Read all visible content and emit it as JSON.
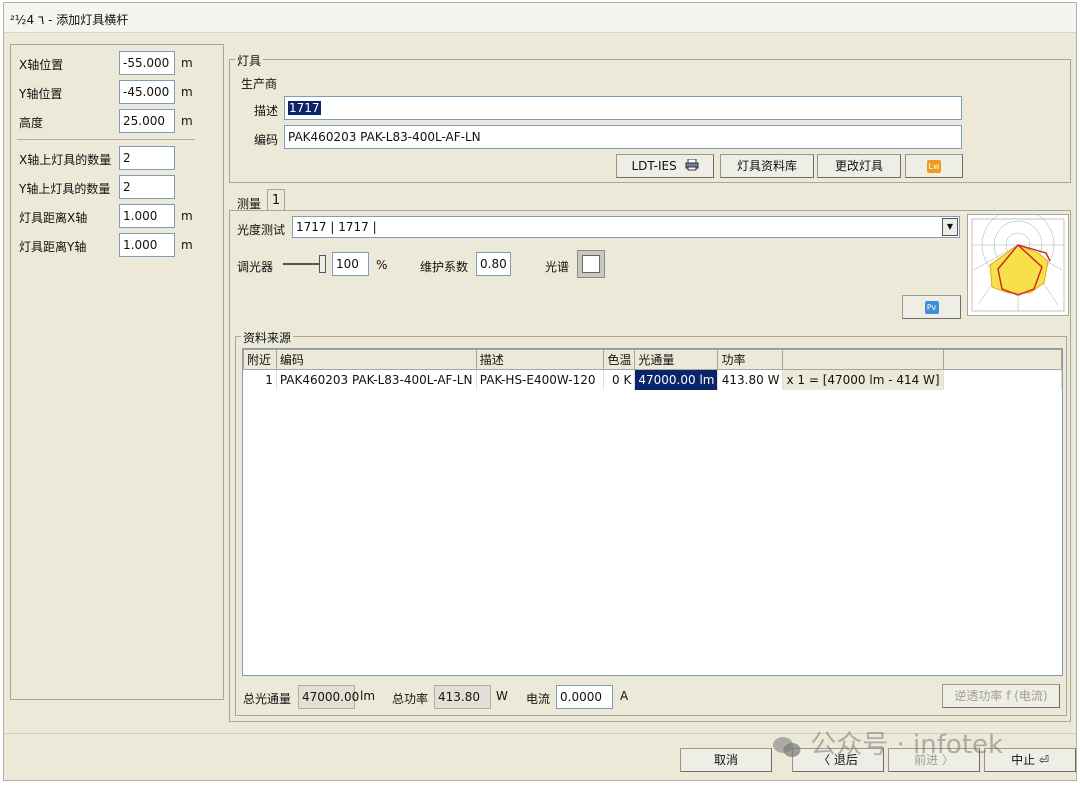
{
  "window": {
    "title": "²½4 ٦ - 添加灯具横杆"
  },
  "left": {
    "rows": [
      {
        "label": "X轴位置",
        "value": "-55.000",
        "unit": "m"
      },
      {
        "label": "Y轴位置",
        "value": "-45.000",
        "unit": "m"
      },
      {
        "label": "高度",
        "value": "25.000",
        "unit": "m"
      },
      {
        "label": "X轴上灯具的数量",
        "value": "2",
        "unit": ""
      },
      {
        "label": "Y轴上灯具的数量",
        "value": "2",
        "unit": ""
      },
      {
        "label": "灯具距离X轴",
        "value": "1.000",
        "unit": "m"
      },
      {
        "label": "灯具距离Y轴",
        "value": "1.000",
        "unit": "m"
      }
    ]
  },
  "luminaire": {
    "group_title": "灯具",
    "manufacturer_label": "生产商",
    "desc_label": "描述",
    "desc_value": "1717",
    "code_label": "编码",
    "code_value": "PAK460203 PAK-L83-400L-AF-LN",
    "buttons": {
      "ldt": "LDT-IES",
      "catalog": "灯具资料库",
      "change": "更改灯具",
      "lw": "Lw"
    }
  },
  "measure": {
    "tab_label": "测量",
    "tab_num": "1",
    "photometry_label": "光度测试",
    "photometry_value": "1717 | 1717 |",
    "dimmer_label": "调光器",
    "dimmer_value": "100",
    "dimmer_unit": "%",
    "maint_label": "维护系数",
    "maint_value": "0.80",
    "spectrum_label": "光谱",
    "pv_label": "Pv"
  },
  "source": {
    "group_title": "资料来源",
    "columns": [
      "附近",
      "编码",
      "描述",
      "色温",
      "光通量",
      "功率",
      ""
    ],
    "rows": [
      [
        "1",
        "PAK460203 PAK-L83-400L-AF-LN",
        "PAK-HS-E400W-120",
        "0 K",
        "47000.00 lm",
        "413.80 W",
        "x 1 = [47000 lm - 414 W]"
      ]
    ]
  },
  "totals": {
    "flux_label": "总光通量",
    "flux_value": "47000.00",
    "flux_unit": "lm",
    "power_label": "总功率",
    "power_value": "413.80",
    "power_unit": "W",
    "current_label": "电流",
    "current_value": "0.0000",
    "current_unit": "A",
    "btn_label": "逆透功率  f (电流)"
  },
  "footer": {
    "cancel": "取消",
    "back": "〈 退后",
    "next": "前进 〉",
    "finish": "中止 ⏎"
  },
  "watermark": "公众号 · infotek"
}
